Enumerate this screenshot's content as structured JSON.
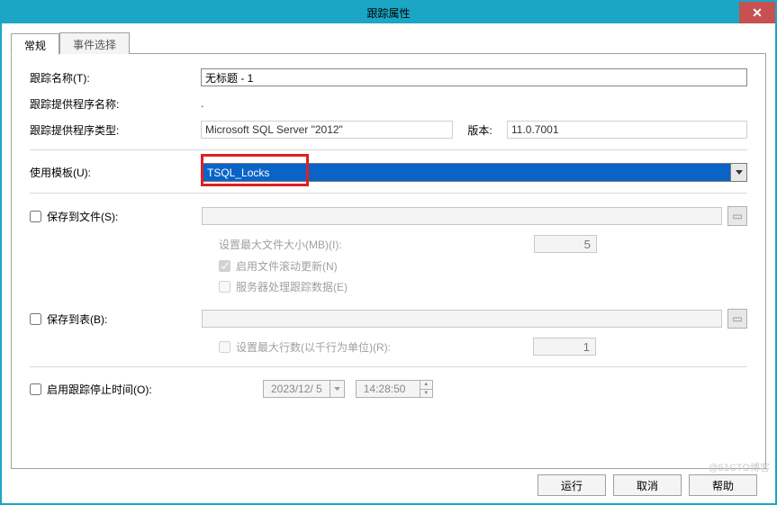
{
  "window": {
    "title": "跟踪属性",
    "close": "✕"
  },
  "tabs": {
    "general": "常规",
    "eventSelect": "事件选择"
  },
  "form": {
    "traceNameLabel": "跟踪名称(T):",
    "traceNameValue": "无标题 - 1",
    "providerNameLabel": "跟踪提供程序名称:",
    "providerNameValue": ".",
    "providerTypeLabel": "跟踪提供程序类型:",
    "providerTypeValue": "Microsoft SQL Server \"2012\"",
    "versionLabel": "版本:",
    "versionValue": "11.0.7001",
    "templateLabel": "使用模板(U):",
    "templateValue": "TSQL_Locks",
    "saveToFileLabel": "保存到文件(S):",
    "maxFileSizeLabel": "设置最大文件大小(MB)(I):",
    "maxFileSizeValue": "5",
    "enableRolloverLabel": "启用文件滚动更新(N)",
    "serverProcessLabel": "服务器处理跟踪数据(E)",
    "saveToTableLabel": "保存到表(B):",
    "maxRowsLabel": "设置最大行数(以千行为单位)(R):",
    "maxRowsValue": "1",
    "stopTimeLabel": "启用跟踪停止时间(O):",
    "stopDate": "2023/12/ 5",
    "stopTime": "14:28:50"
  },
  "buttons": {
    "run": "运行",
    "cancel": "取消",
    "help": "帮助"
  },
  "watermark": "@51CTO博客"
}
